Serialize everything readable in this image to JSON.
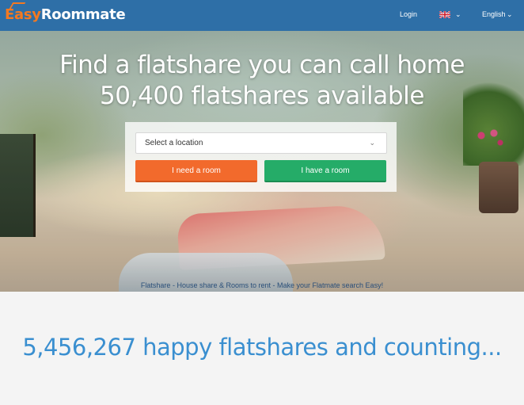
{
  "header": {
    "logo_easy": "Easy",
    "logo_roommate": "Roommate",
    "login_label": "Login",
    "flag_icon": "uk-flag-icon",
    "language_label": "English",
    "colors": {
      "bar": "#2e6fa7",
      "logo_accent": "#f47920"
    }
  },
  "hero": {
    "title_line1": "Find a flatshare you can call home",
    "title_line2": "50,400 flatshares available",
    "search": {
      "location_placeholder": "Select a location",
      "need_room_label": "I need a room",
      "have_room_label": "I have a room",
      "colors": {
        "need": "#f26a2c",
        "have": "#25ac68"
      }
    },
    "tagline": {
      "part1": "Flatshare",
      "sep1": " - ",
      "part2": "House share & Rooms to rent",
      "sep2": " - ",
      "part3": "Make your Flatmate search Easy!"
    }
  },
  "stats": {
    "counter_text": "5,456,267 happy flatshares and counting..."
  }
}
